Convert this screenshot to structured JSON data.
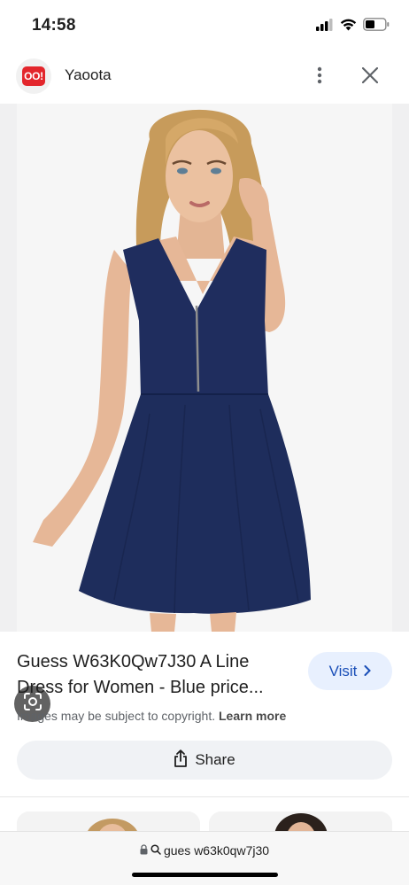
{
  "status_bar": {
    "time": "14:58",
    "icons": [
      "signal-icon",
      "wifi-icon",
      "battery-icon"
    ]
  },
  "header": {
    "logo_text": "OO!",
    "site_name": "Yaoota",
    "icons": [
      "more-vert-icon",
      "close-icon"
    ]
  },
  "image": {
    "description_icon": "lens-icon"
  },
  "result": {
    "title_line1": "Guess W63K0Qw7J30 A Line",
    "title_line2": "Dress for Women - Blue price...",
    "visit_label": "Visit",
    "copyright_text": "Images may be subject to copyright.",
    "learn_more": "Learn more",
    "share_label": "Share"
  },
  "url_bar": {
    "query": "gues w63k0qw7j30"
  },
  "colors": {
    "accent_blue": "#1a4fb8",
    "visit_bg": "#e8f0fe",
    "logo_red": "#e3262c",
    "dress_navy": "#1e2d5c"
  }
}
